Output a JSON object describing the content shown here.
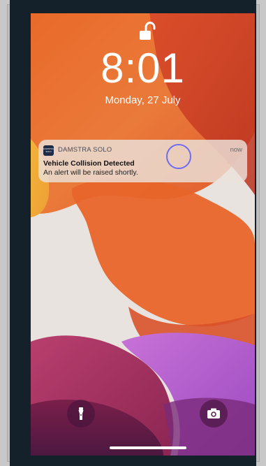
{
  "lock_screen": {
    "time": "8:01",
    "date": "Monday, 27 July"
  },
  "notification": {
    "app_name": "DAMSTRA SOLO",
    "app_icon_text": "DAMSTRA SOLO",
    "time": "now",
    "title": "Vehicle Collision Detected",
    "body": "An alert will be raised shortly."
  },
  "icons": {
    "lock": "unlocked-padlock-icon",
    "flashlight": "flashlight-icon",
    "camera": "camera-icon"
  },
  "colors": {
    "touch_indicator": "#6f6cf0",
    "frame": "#14212b"
  }
}
